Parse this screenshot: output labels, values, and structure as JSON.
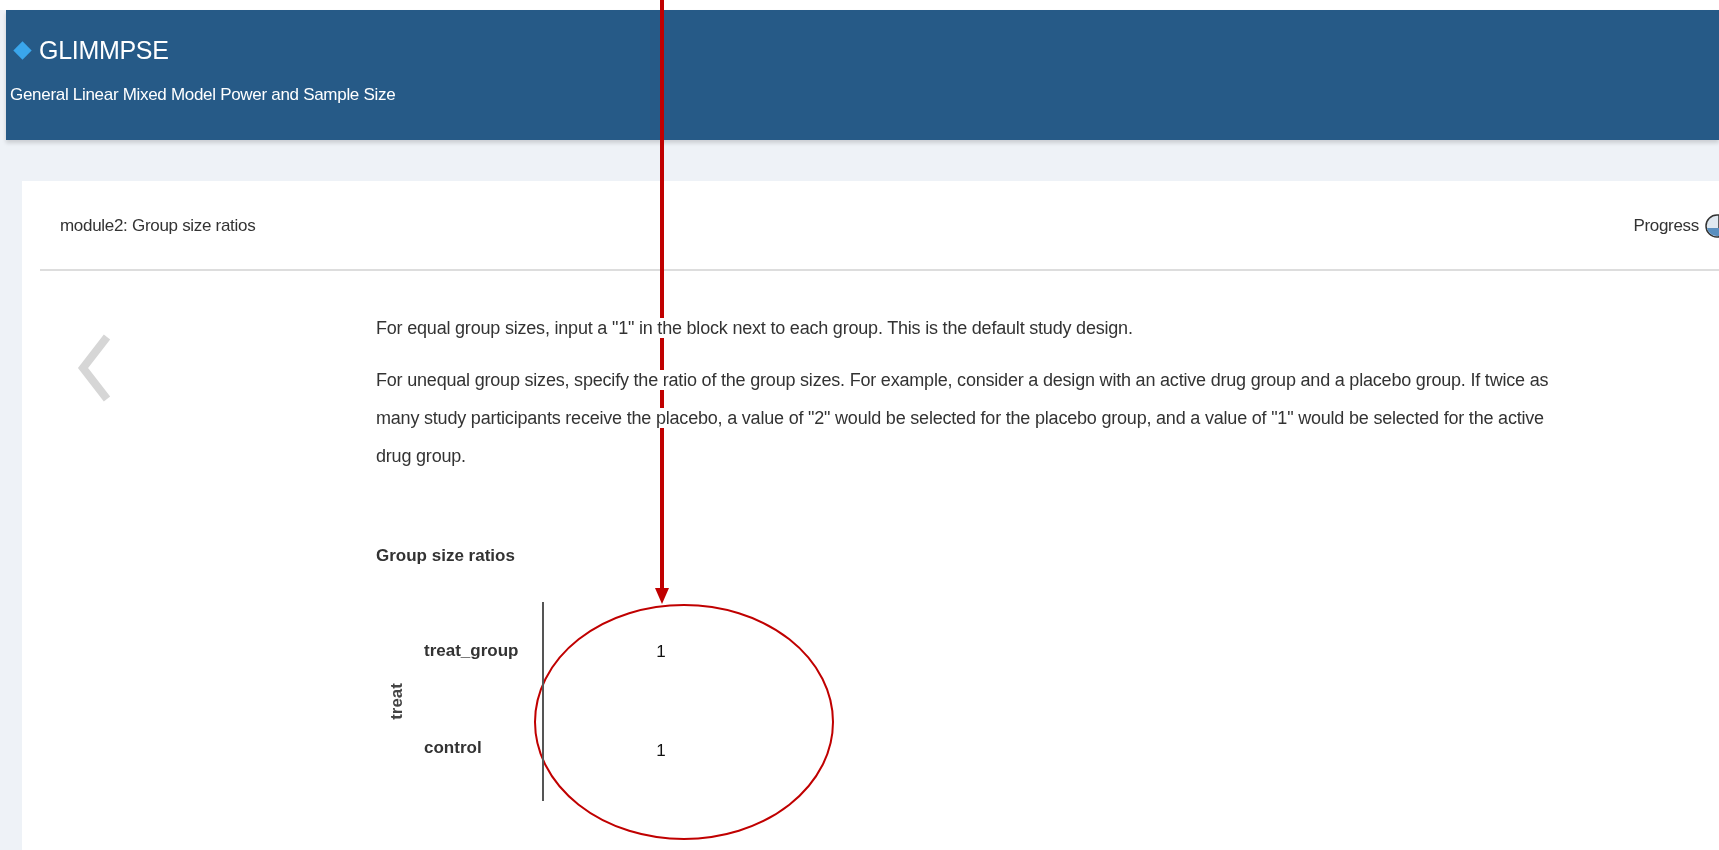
{
  "header": {
    "title": "GLIMMPSE",
    "subtitle": "General Linear Mixed Model Power and Sample Size"
  },
  "card": {
    "title": "module2: Group size ratios",
    "progress_label": "Progress"
  },
  "paragraphs": [
    "For equal group sizes, input a \"1\" in the block next to each group. This is the default study design.",
    "For unequal group sizes, specify the ratio of the group sizes. For example, consider a design with an active drug group and a placebo group. If twice as many study participants receive the placebo, a value of \"2\" would be selected for the placebo group, and a value of \"1\" would be selected for the active drug group."
  ],
  "ratio_table": {
    "heading": "Group size ratios",
    "factor": "treat",
    "rows": [
      {
        "label": "treat_group",
        "value": "1"
      },
      {
        "label": "control",
        "value": "1"
      }
    ]
  }
}
